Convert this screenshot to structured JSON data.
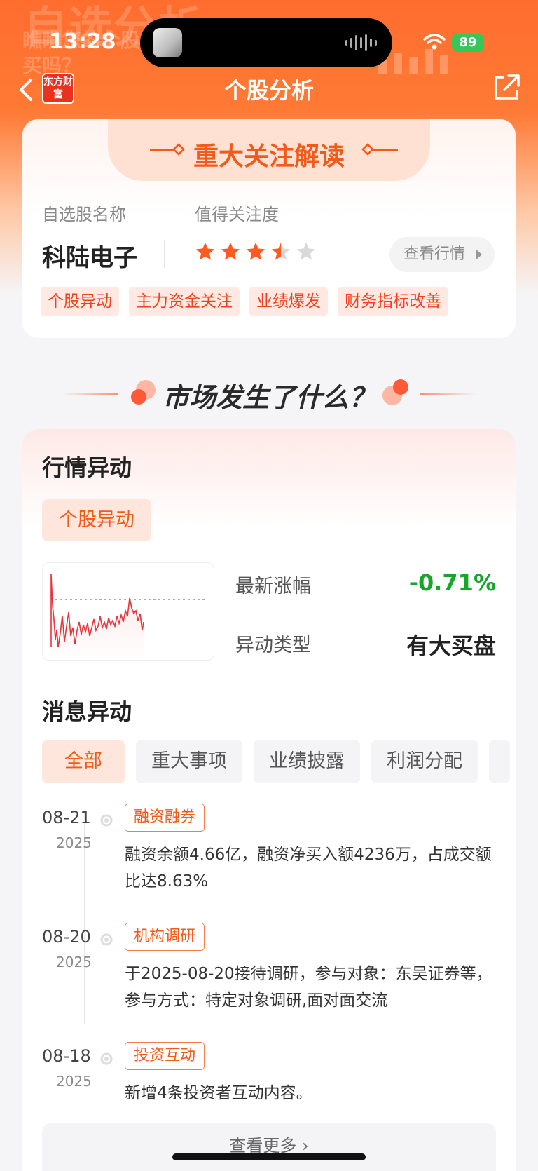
{
  "status_bar": {
    "time": "13:28",
    "battery": "89"
  },
  "hero": {
    "ghost_title": "自选分析",
    "ghost_subtitle": "瞧瞧您的个股 买吗？"
  },
  "nav": {
    "logo_text": "东方财富",
    "title": "个股分析"
  },
  "focus_card": {
    "title": "重大关注解读",
    "name_label": "自选股名称",
    "attention_label": "值得关注度",
    "stock_name": "科陆电子",
    "attention_stars": 3.5,
    "attention_max": 5,
    "quote_button": "查看行情",
    "tags": [
      "个股异动",
      "主力资金关注",
      "业绩爆发",
      "财务指标改善"
    ]
  },
  "section_title": "市场发生了什么？",
  "market_card": {
    "title": "行情异动",
    "subtag": "个股异动",
    "latest_change_label": "最新涨幅",
    "latest_change_value": "-0.71%",
    "anomaly_type_label": "异动类型",
    "anomaly_type_value": "有大买盘",
    "news_title": "消息异动",
    "filters": [
      "全部",
      "重大事项",
      "业绩披露",
      "利润分配"
    ],
    "timeline": [
      {
        "date": "08-21",
        "year": "2025",
        "tag": "融资融券",
        "text": "融资余额4.66亿，融资净买入额4236万，占成交额比达8.63%"
      },
      {
        "date": "08-20",
        "year": "2025",
        "tag": "机构调研",
        "text": "于2025-08-20接待调研，参与对象：东吴证券等，参与方式：特定对象调研,面对面交流"
      },
      {
        "date": "08-18",
        "year": "2025",
        "tag": "投资互动",
        "text": "新增4条投资者互动内容。"
      }
    ],
    "more_button": "查看更多"
  },
  "colors": {
    "brand": "#ff6d2e",
    "accent": "#f25a1a",
    "down_green": "#19a52a",
    "tag_red": "#f0401f"
  }
}
